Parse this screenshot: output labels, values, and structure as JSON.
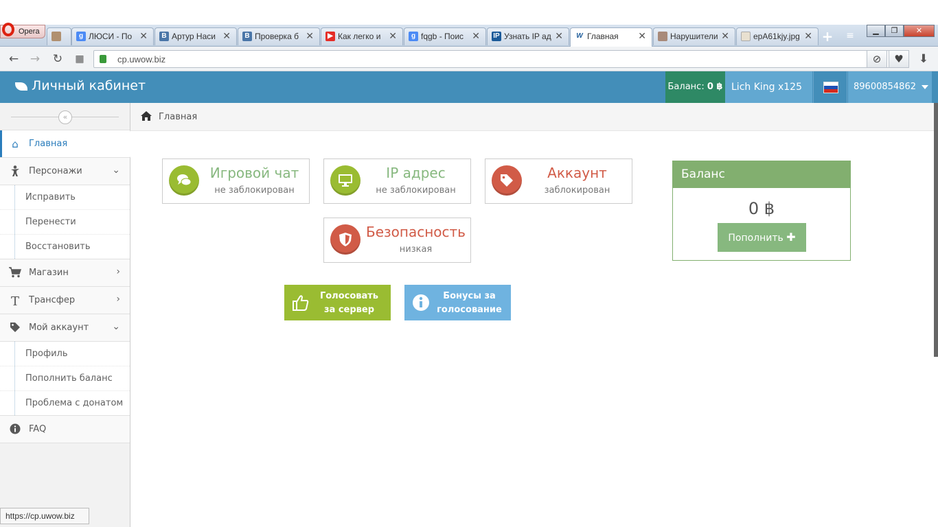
{
  "browser": {
    "menu_label": "Opera",
    "tabs": [
      {
        "title": "",
        "favicon": "image-icon"
      },
      {
        "title": "ЛЮСИ - По",
        "favicon": "google-icon"
      },
      {
        "title": "Артур Наси",
        "favicon": "vk-icon"
      },
      {
        "title": "Проверка б",
        "favicon": "vk-icon"
      },
      {
        "title": "Как легко и",
        "favicon": "youtube-icon"
      },
      {
        "title": "fqgb - Поис",
        "favicon": "google-icon"
      },
      {
        "title": "Узнать IP ад",
        "favicon": "ip-icon"
      },
      {
        "title": "Главная",
        "favicon": "w-icon"
      },
      {
        "title": "Нарушители",
        "favicon": "image-icon"
      },
      {
        "title": "epA61kjy.jpg",
        "favicon": "file-icon"
      }
    ],
    "url": "cp.uwow.biz",
    "status_url": "https://cp.uwow.biz"
  },
  "header": {
    "brand": "Личный кабинет",
    "balance_label": "Баланс:",
    "balance_value": "0 ฿",
    "realm": "Lich King x125",
    "phone": "89600854862"
  },
  "sidebar": {
    "items": [
      {
        "label": "Главная",
        "icon": "home-icon"
      },
      {
        "label": "Персонажи",
        "icon": "person-icon",
        "sub": [
          "Исправить",
          "Перенести",
          "Восстановить"
        ]
      },
      {
        "label": "Магазин",
        "icon": "cart-icon"
      },
      {
        "label": "Трансфер",
        "icon": "text-icon"
      },
      {
        "label": "Мой аккаунт",
        "icon": "tag-icon",
        "sub": [
          "Профиль",
          "Пополнить баланс",
          "Проблема с донатом"
        ]
      },
      {
        "label": "FAQ",
        "icon": "info-icon"
      }
    ]
  },
  "breadcrumb": {
    "label": "Главная"
  },
  "status": {
    "chat": {
      "title": "Игровой чат",
      "sub": "не заблокирован"
    },
    "ip": {
      "title": "IP адрес",
      "sub": "не заблокирован"
    },
    "account": {
      "title": "Аккаунт",
      "sub": "заблокирован"
    },
    "security": {
      "title": "Безопасность",
      "sub": "низкая"
    }
  },
  "balance": {
    "title": "Баланс",
    "amount": "0 ฿",
    "topup_label": "Пополнить"
  },
  "vote": {
    "vote_line1": "Голосовать",
    "vote_line2": "за сервер",
    "bonus_line1": "Бонусы за",
    "bonus_line2": "голосование"
  },
  "colors": {
    "header": "#438eb9",
    "balance_badge": "#2e8965",
    "ok": "#9abc32",
    "bad": "#d15b47",
    "vote": "#9abc32",
    "bonus": "#6fb3e0"
  }
}
